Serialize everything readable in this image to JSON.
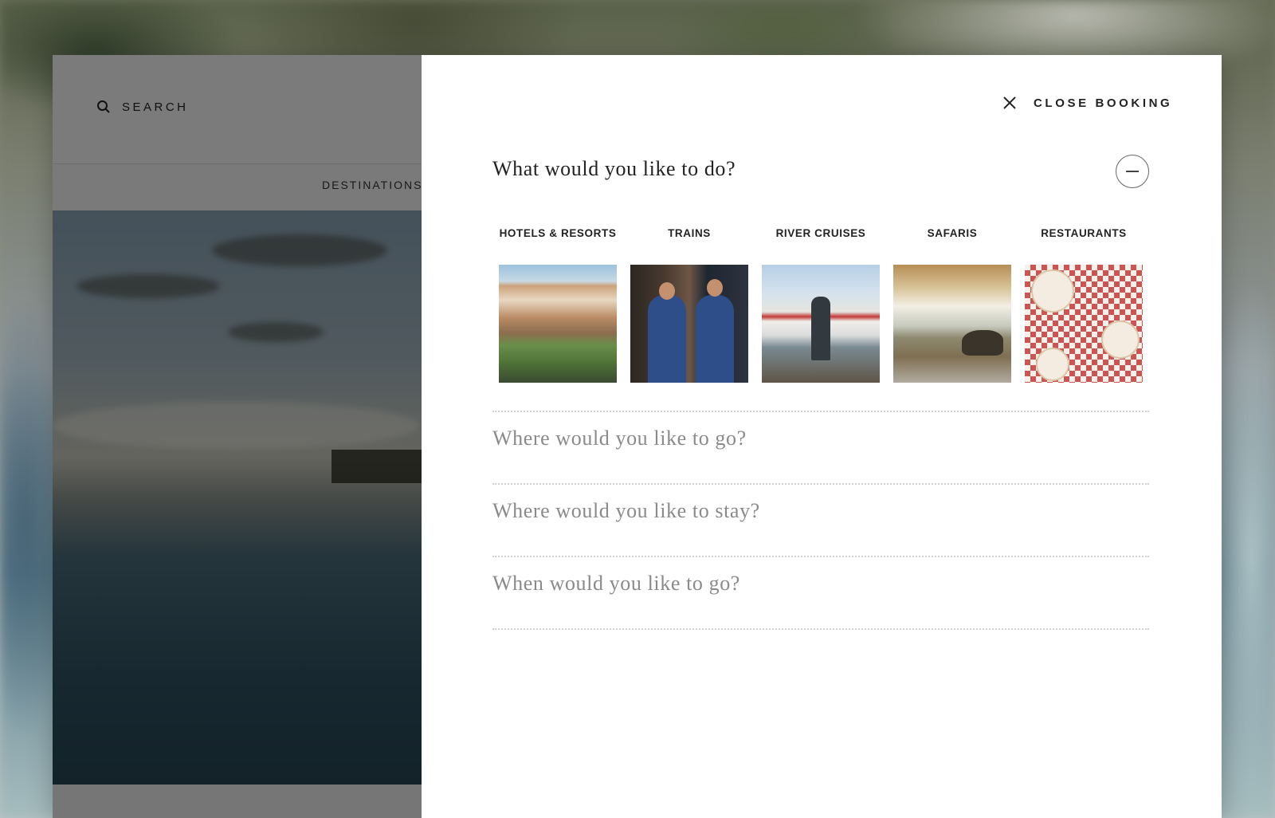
{
  "site": {
    "search_label": "SEARCH",
    "nav_destinations": "DESTINATIONS"
  },
  "booking": {
    "close_label": "CLOSE BOOKING",
    "question_active": "What would you like to do?",
    "categories": [
      {
        "label": "HOTELS & RESORTS",
        "image": "hotel-photo"
      },
      {
        "label": "TRAINS",
        "image": "train-porters-photo"
      },
      {
        "label": "RIVER CRUISES",
        "image": "river-cruise-photo"
      },
      {
        "label": "SAFARIS",
        "image": "safari-elephant-photo"
      },
      {
        "label": "RESTAURANTS",
        "image": "restaurant-table-photo"
      }
    ],
    "question_where_go": "Where would you like to go?",
    "question_where_stay": "Where would you like to stay?",
    "question_when_go": "When would you like to go?"
  },
  "colors": {
    "panel_bg": "#ffffff",
    "text_dark": "#222222",
    "text_muted": "#8a8a8a",
    "divider": "#cfcfcf"
  }
}
